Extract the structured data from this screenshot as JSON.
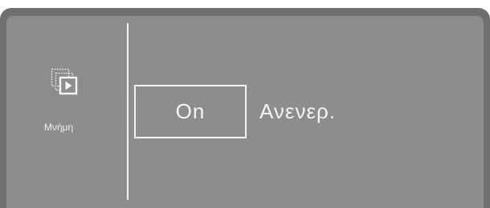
{
  "sidebar": {
    "item": {
      "icon": "memory-play-icon",
      "label": "Μνήμη"
    }
  },
  "main": {
    "options": [
      {
        "label": "On",
        "selected": true
      },
      {
        "label": "Ανενερ.",
        "selected": false
      }
    ]
  },
  "colors": {
    "bezel": "#6f6f6f",
    "screen": "#8d8d8d",
    "foreground": "#f4f4f4"
  }
}
